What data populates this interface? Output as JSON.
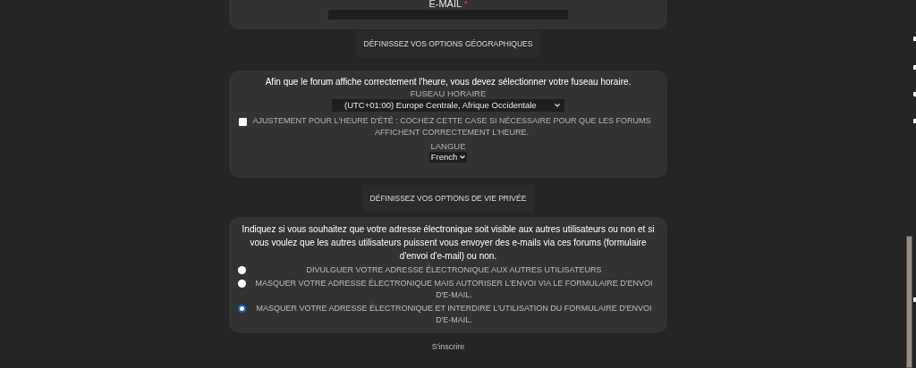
{
  "email": {
    "label": "E-MAIL",
    "required_mark": "*"
  },
  "geo_button": "DÉFINISSEZ VOS OPTIONS GÉOGRAPHIQUES",
  "geo": {
    "intro": "Afin que le forum affiche correctement l'heure, vous devez sélectionner votre fuseau horaire.",
    "timezone_label": "FUSEAU HORAIRE",
    "timezone_value": "(UTC+01:00) Europe Centrale, Afrique Occidentale",
    "dst": {
      "label": "AJUSTEMENT POUR L'HEURE D'ÉTÉ : COCHEZ CETTE CASE SI NÉCESSAIRE POUR QUE LES FORUMS AFFICHENT CORRECTEMENT L'HEURE.",
      "checked": false
    },
    "language_label": "LANGUE",
    "language_value": "French"
  },
  "privacy_button": "DÉFINISSEZ VOS OPTIONS DE VIE PRIVÉE",
  "privacy": {
    "intro": "Indiquez si vous souhaitez que votre adresse électronique soit visible aux autres utilisateurs ou non et si vous voulez que les autres utilisateurs puissent vous envoyer des e-mails via ces forums (formulaire d'envoi d'e-mail) ou non.",
    "options": [
      {
        "label": "DIVULGUER VOTRE ADRESSE ÉLECTRONIQUE AUX AUTRES UTILISATEURS",
        "selected": false
      },
      {
        "label": "MASQUER VOTRE ADRESSE ÉLECTRONIQUE MAIS AUTORISER L'ENVOI VIA LE FORMULAIRE D'ENVOI D'E-MAIL.",
        "selected": false
      },
      {
        "label": "MASQUER VOTRE ADRESSE ÉLECTRONIQUE ET INTERDIRE L'UTILISATION DU FORMULAIRE D'ENVOI D'E-MAIL.",
        "selected": true
      }
    ]
  },
  "submit_button": "S'inscrire"
}
